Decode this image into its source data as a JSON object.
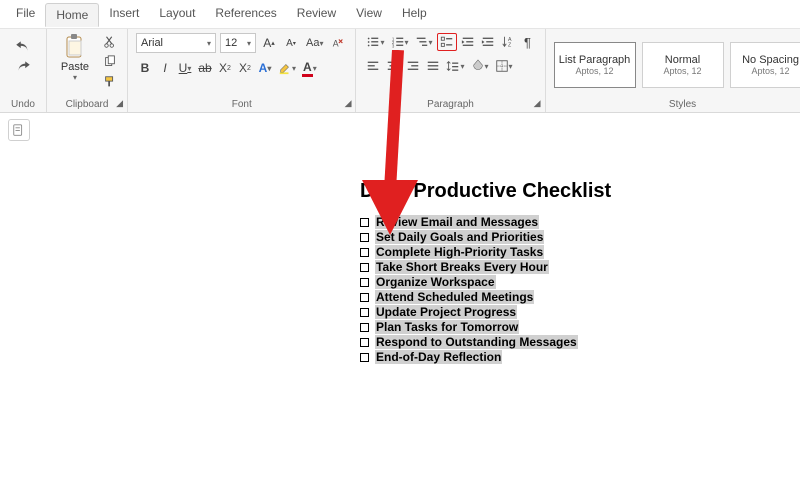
{
  "menu": {
    "file": "File",
    "home": "Home",
    "insert": "Insert",
    "layout": "Layout",
    "references": "References",
    "review": "Review",
    "view": "View",
    "help": "Help"
  },
  "undo_label": "Undo",
  "clipboard": {
    "paste_label": "Paste",
    "group_label": "Clipboard"
  },
  "font": {
    "name": "Arial",
    "size": "12",
    "group_label": "Font"
  },
  "paragraph": {
    "group_label": "Paragraph"
  },
  "styles": {
    "group_label": "Styles",
    "items": [
      {
        "name": "List Paragraph",
        "sub": "Aptos, 12",
        "selected": true
      },
      {
        "name": "Normal",
        "sub": "Aptos, 12",
        "selected": false
      },
      {
        "name": "No Spacing",
        "sub": "Aptos, 12",
        "selected": false
      }
    ]
  },
  "document": {
    "title": "Daily Productive Checklist",
    "items": [
      "Review Email and Messages",
      "Set Daily Goals and Priorities",
      " Complete High-Priority Tasks",
      "Take Short Breaks Every Hour",
      "Organize Workspace",
      " Attend Scheduled Meetings",
      "Update Project Progress",
      " Plan Tasks for Tomorrow",
      "Respond to Outstanding Messages",
      "End-of-Day Reflection"
    ]
  }
}
